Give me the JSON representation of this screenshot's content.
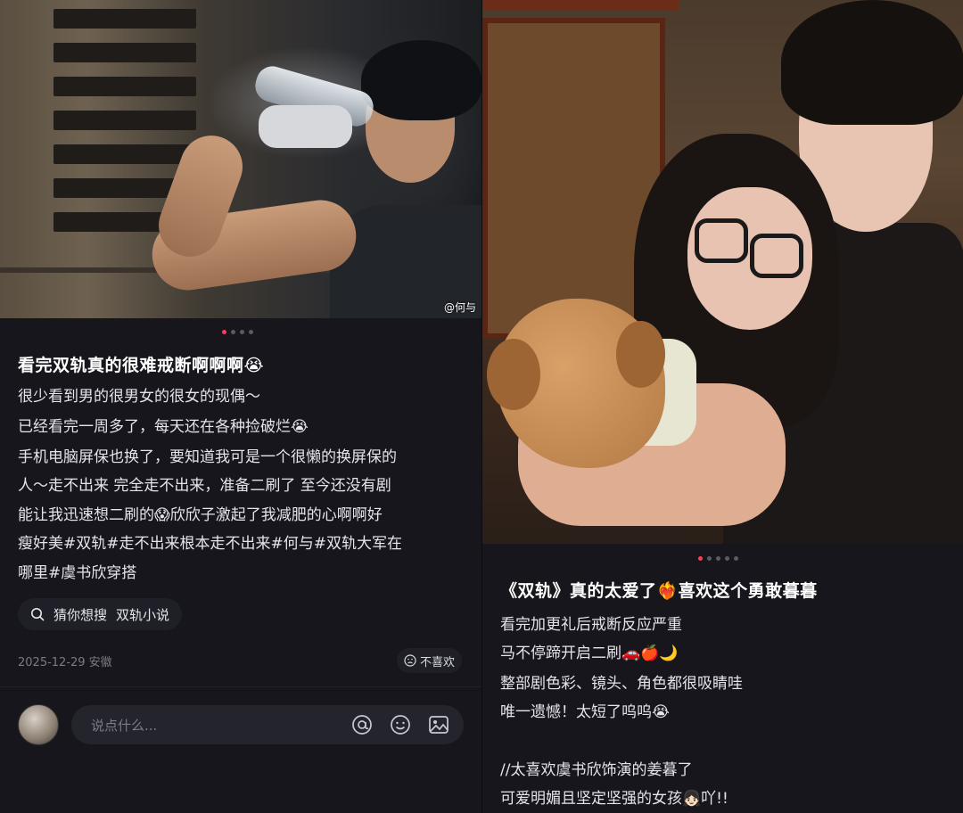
{
  "left_post": {
    "photo_watermark": "@何与",
    "carousel": {
      "count": 4,
      "active": 0
    },
    "title": "看完双轨真的很难戒断啊啊啊😭",
    "body_lines": [
      "很少看到男的很男女的很女的现偶～",
      "已经看完一周多了，每天还在各种捡破烂😭",
      "手机电脑屏保也换了，要知道我可是一个很懒的换屏保的",
      "人～走不出来 完全走不出来，准备二刷了 至今还没有剧",
      "能让我迅速想二刷的😱欣欣子激起了我减肥的心啊啊好",
      "瘦好美#双轨#走不出来根本走不出来#何与#双轨大军在",
      "哪里#虞书欣穿搭"
    ],
    "search_chip": {
      "label": "猜你想搜",
      "query": "双轨小说"
    },
    "date_location": "2025-12-29 安徽",
    "dislike_label": "不喜欢",
    "comment_placeholder": "说点什么..."
  },
  "right_post": {
    "carousel": {
      "count": 5,
      "active": 0
    },
    "title": "《双轨》真的太爱了❤️‍🔥喜欢这个勇敢暮暮",
    "body_lines": [
      "看完加更礼后戒断反应严重",
      "马不停蹄开启二刷🚗🍎🌙",
      "整部剧色彩、镜头、角色都很吸睛哇",
      "唯一遗憾！太短了呜呜😭",
      "",
      "//太喜欢虞书欣饰演的姜暮了",
      "可爱明媚且坚定坚强的女孩👧🏻吖!!"
    ]
  },
  "icons": {
    "search": "search-icon",
    "dislike": "frown-face-icon",
    "mention": "at-sign-icon",
    "emoji": "smile-face-icon",
    "image": "image-icon"
  },
  "colors": {
    "background": "#16161c",
    "accent_dot": "#ff3b5c",
    "muted_text": "#7b7b86"
  }
}
